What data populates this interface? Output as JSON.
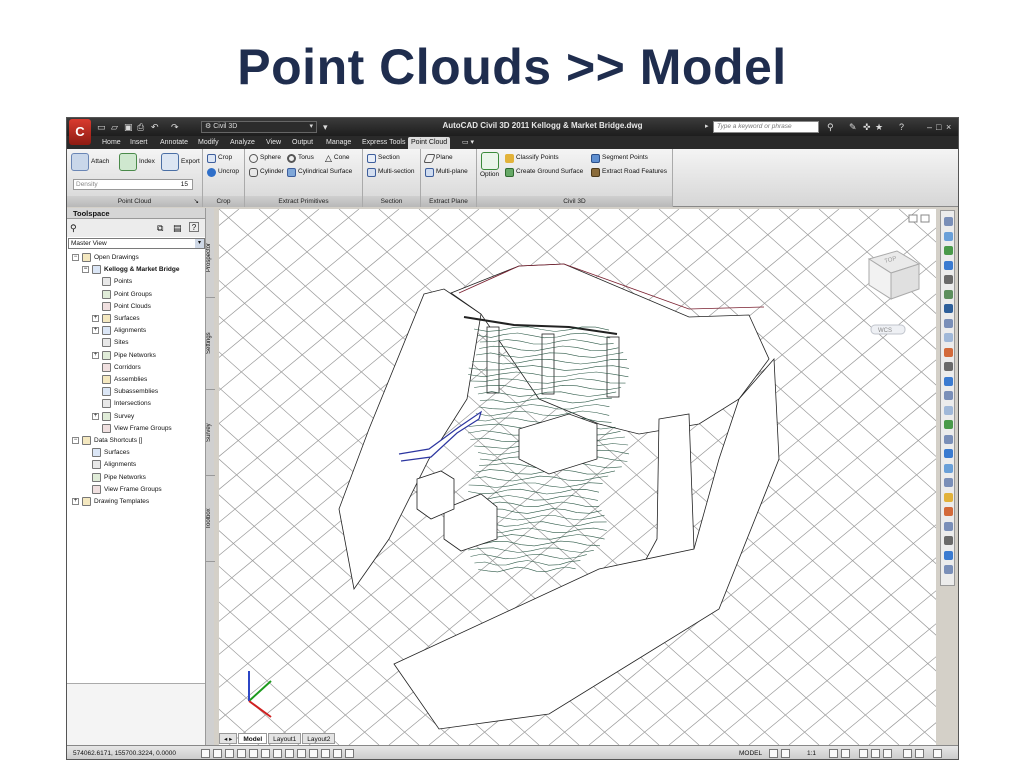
{
  "slide": {
    "title": "Point Clouds >> Model"
  },
  "app": {
    "title": "AutoCAD Civil 3D 2011   Kellogg & Market Bridge.dwg",
    "workspace": "Civil 3D",
    "search_placeholder": "Type a keyword or phrase",
    "logo": "C"
  },
  "menu_tabs": [
    "Home",
    "Insert",
    "Annotate",
    "Modify",
    "Analyze",
    "View",
    "Output",
    "Manage",
    "Express Tools",
    "Point Cloud"
  ],
  "active_tab": "Point Cloud",
  "ribbon": {
    "point_cloud": {
      "title": "Point Cloud",
      "attach": "Attach",
      "index": "Index",
      "export": "Export",
      "density_label": "Density",
      "density_value": "15"
    },
    "crop": {
      "title": "Crop",
      "crop": "Crop",
      "uncrop": "Uncrop"
    },
    "extract_primitives": {
      "title": "Extract Primitives",
      "sphere": "Sphere",
      "torus": "Torus",
      "cone": "Cone",
      "cylinder": "Cylinder",
      "cylindrical_surface": "Cylindrical Surface"
    },
    "section": {
      "title": "Section",
      "section": "Section",
      "multi_section": "Multi-section"
    },
    "extract_plane": {
      "title": "Extract Plane",
      "plane": "Plane",
      "multi_plane": "Multi-plane"
    },
    "civil3d": {
      "title": "Civil 3D",
      "option": "Option",
      "classify_points": "Classify Points",
      "create_ground_surface": "Create Ground Surface",
      "segment_points": "Segment Points",
      "extract_road_features": "Extract Road Features"
    }
  },
  "toolspace": {
    "title": "Toolspace",
    "view": "Master View",
    "tree": [
      {
        "label": "Open Drawings",
        "level": 0,
        "expander": "−",
        "bold": false
      },
      {
        "label": "Kellogg & Market Bridge",
        "level": 1,
        "expander": "−",
        "bold": true
      },
      {
        "label": "Points",
        "level": 2,
        "expander": "",
        "bold": false
      },
      {
        "label": "Point Groups",
        "level": 2,
        "expander": "",
        "bold": false
      },
      {
        "label": "Point Clouds",
        "level": 2,
        "expander": "",
        "bold": false
      },
      {
        "label": "Surfaces",
        "level": 2,
        "expander": "+",
        "bold": false
      },
      {
        "label": "Alignments",
        "level": 2,
        "expander": "+",
        "bold": false
      },
      {
        "label": "Sites",
        "level": 2,
        "expander": "",
        "bold": false
      },
      {
        "label": "Pipe Networks",
        "level": 2,
        "expander": "+",
        "bold": false
      },
      {
        "label": "Corridors",
        "level": 2,
        "expander": "",
        "bold": false
      },
      {
        "label": "Assemblies",
        "level": 2,
        "expander": "",
        "bold": false
      },
      {
        "label": "Subassemblies",
        "level": 2,
        "expander": "",
        "bold": false
      },
      {
        "label": "Intersections",
        "level": 2,
        "expander": "",
        "bold": false
      },
      {
        "label": "Survey",
        "level": 2,
        "expander": "+",
        "bold": false
      },
      {
        "label": "View Frame Groups",
        "level": 2,
        "expander": "",
        "bold": false
      },
      {
        "label": "Data Shortcuts []",
        "level": 0,
        "expander": "−",
        "bold": false
      },
      {
        "label": "Surfaces",
        "level": 1,
        "expander": "",
        "bold": false
      },
      {
        "label": "Alignments",
        "level": 1,
        "expander": "",
        "bold": false
      },
      {
        "label": "Pipe Networks",
        "level": 1,
        "expander": "",
        "bold": false
      },
      {
        "label": "View Frame Groups",
        "level": 1,
        "expander": "",
        "bold": false
      },
      {
        "label": "Drawing Templates",
        "level": 0,
        "expander": "+",
        "bold": false
      }
    ],
    "side_tabs": [
      "Prospector",
      "Settings",
      "Survey",
      "Toolbox"
    ]
  },
  "layout_tabs": [
    "Model",
    "Layout1",
    "Layout2"
  ],
  "active_layout": "Model",
  "status": {
    "coords": "574062.6171, 155700.3224, 0.0000",
    "model": "MODEL",
    "scale": "1:1"
  },
  "viewcube": {
    "face": "TOP",
    "wcs": "WCS"
  }
}
